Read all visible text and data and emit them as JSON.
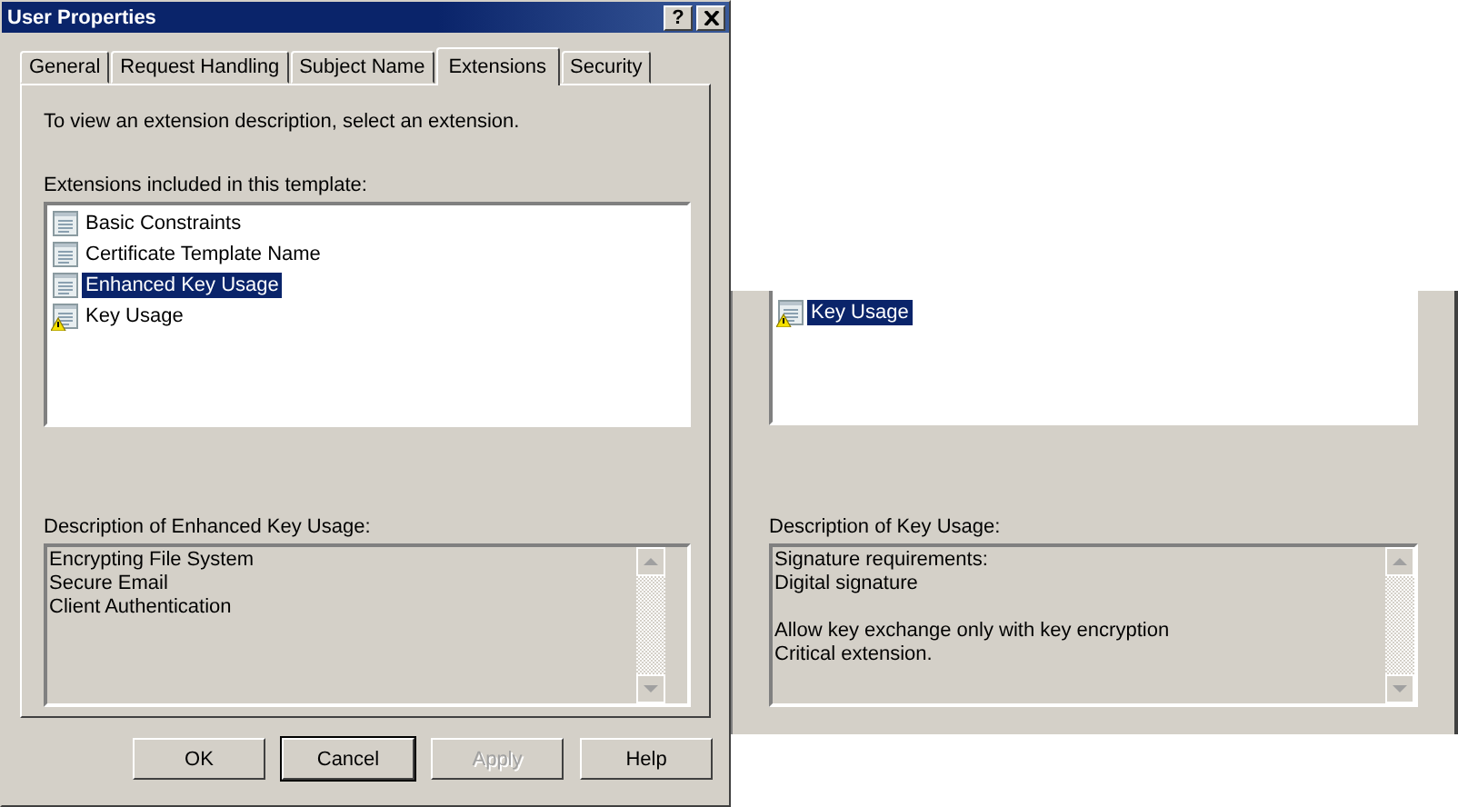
{
  "window": {
    "title": "User Properties",
    "help_button": "?"
  },
  "tabs": [
    {
      "label": "General",
      "selected": false
    },
    {
      "label": "Request Handling",
      "selected": false
    },
    {
      "label": "Subject Name",
      "selected": false
    },
    {
      "label": "Extensions",
      "selected": true
    },
    {
      "label": "Security",
      "selected": false
    }
  ],
  "intro": "To view an extension description, select an extension.",
  "list_label": "Extensions included in this template:",
  "extensions": [
    {
      "label": "Basic Constraints",
      "selected": false,
      "warning": false
    },
    {
      "label": "Certificate Template Name",
      "selected": false,
      "warning": false
    },
    {
      "label": "Enhanced Key Usage",
      "selected": true,
      "warning": false
    },
    {
      "label": "Key Usage",
      "selected": false,
      "warning": true
    }
  ],
  "description_label": "Description of Enhanced Key Usage:",
  "description": [
    [
      "Encrypting File System",
      "Secure Email",
      "Client Authentication"
    ]
  ],
  "buttons": [
    {
      "label": "OK",
      "disabled": false,
      "default": false
    },
    {
      "label": "Cancel",
      "disabled": false,
      "default": true
    },
    {
      "label": "Apply",
      "disabled": true,
      "default": false
    },
    {
      "label": "Help",
      "disabled": false,
      "default": false
    }
  ],
  "detail_view": {
    "extensions": [
      {
        "label": "Key Usage",
        "selected": true,
        "warning": true
      }
    ],
    "description_label": "Description of Key Usage:",
    "description": [
      [
        "Signature requirements:",
        "Digital signature"
      ],
      [
        "Allow key exchange only with key encryption",
        "Critical extension."
      ]
    ]
  }
}
